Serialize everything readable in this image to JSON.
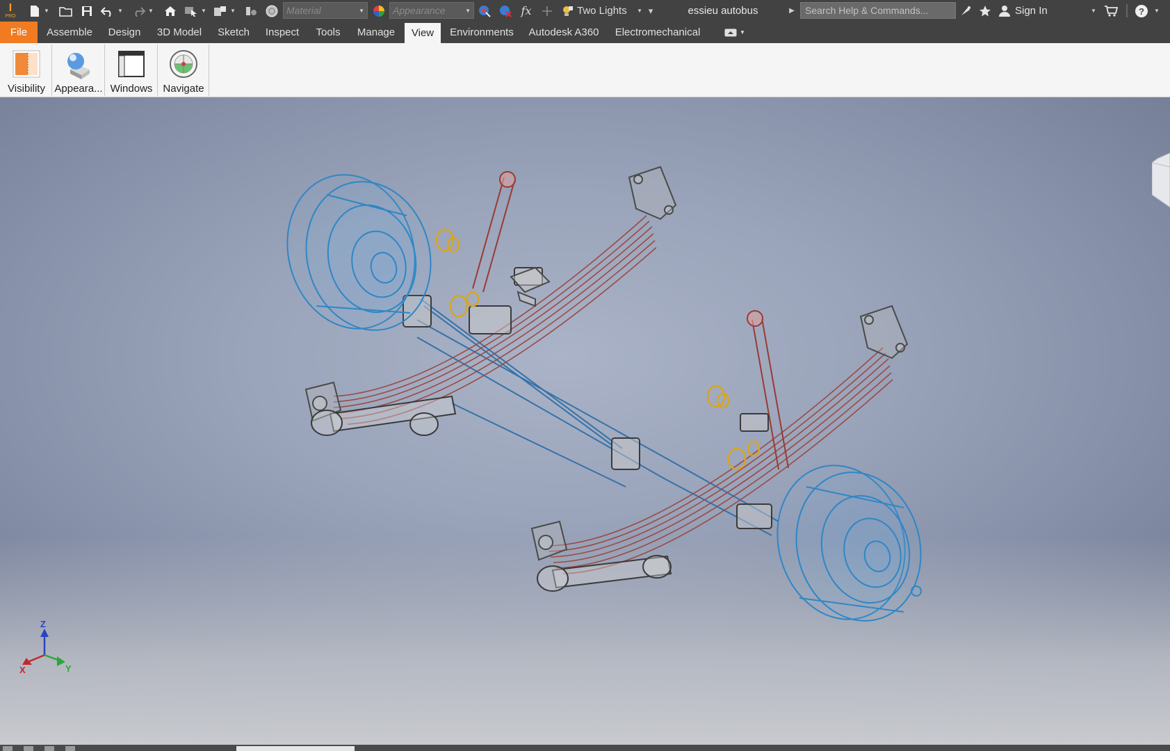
{
  "quick_access": {
    "app_logo_letter": "I",
    "app_logo_sub": "PRO",
    "material_placeholder": "Material",
    "appearance_placeholder": "Appearance",
    "fx_label": "fx",
    "lighting_style": "Two Lights",
    "document_name": "essieu autobus",
    "search_placeholder": "Search Help & Commands...",
    "sign_in_label": "Sign In"
  },
  "ribbon_tabs": [
    {
      "label": "File"
    },
    {
      "label": "Assemble"
    },
    {
      "label": "Design"
    },
    {
      "label": "3D Model"
    },
    {
      "label": "Sketch"
    },
    {
      "label": "Inspect"
    },
    {
      "label": "Tools"
    },
    {
      "label": "Manage"
    },
    {
      "label": "View",
      "active": true
    },
    {
      "label": "Environments"
    },
    {
      "label": "Autodesk A360"
    },
    {
      "label": "Electromechanical"
    }
  ],
  "ribbon_panels": [
    {
      "label": "Visibility",
      "icon": "visibility-icon"
    },
    {
      "label": "Appeara...",
      "icon": "appearance-icon"
    },
    {
      "label": "Windows",
      "icon": "windows-icon"
    },
    {
      "label": "Navigate",
      "icon": "navigate-icon"
    }
  ],
  "triad": {
    "z": "Z",
    "x": "X",
    "y": "Y"
  },
  "colors": {
    "file_tab": "#f07b20",
    "wheel_blue": "#2f86c6",
    "spring_red": "#9a4a44",
    "part_gray": "#5a5a5a",
    "bushing_yellow": "#d9a51c"
  }
}
